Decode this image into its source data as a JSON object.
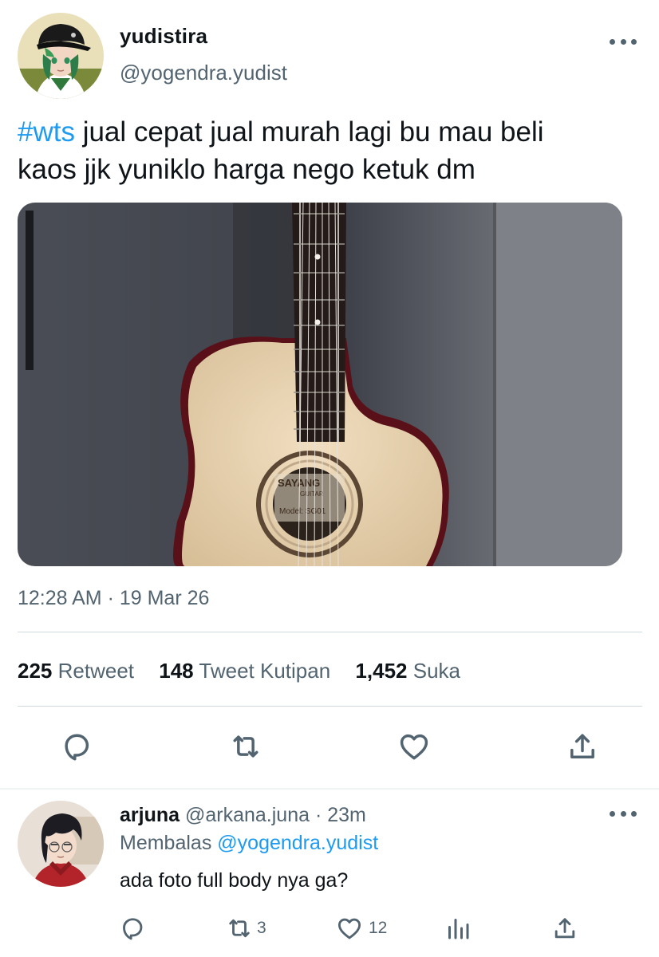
{
  "main_tweet": {
    "name": "yudistira",
    "handle": "@yogendra.yudist",
    "hashtag": "#wts",
    "text_line1": " jual cepat jual murah lagi bu mau beli",
    "text_line2": "kaos jjk yuniklo harga nego ketuk dm",
    "photo_brand": "SAYANG",
    "photo_sub": "GUITAR",
    "photo_model": "Model: SG01",
    "timestamp": "12:28 AM · 19 Mar 26",
    "stats": {
      "retweets": "225",
      "retweets_label": "Retweet",
      "quotes": "148",
      "quotes_label": "Tweet Kutipan",
      "likes": "1,452",
      "likes_label": "Suka"
    },
    "actions": [
      "reply-icon",
      "retweet-icon",
      "like-icon",
      "share-icon"
    ]
  },
  "reply": {
    "name": "arjuna",
    "handle": "@arkana.juna",
    "separator": " · ",
    "time": "23m",
    "replying_label": "Membalas",
    "replying_to": "@yogendra.yudist",
    "text": "ada foto full body nya ga?",
    "retweet_count": "3",
    "like_count": "12",
    "actions": [
      "reply-icon",
      "retweet-icon",
      "like-icon",
      "analytics-icon",
      "share-icon"
    ]
  },
  "colors": {
    "accent": "#1d9bf0",
    "text": "#0f1419",
    "secondary": "#536471",
    "divider": "#cfd9de"
  }
}
